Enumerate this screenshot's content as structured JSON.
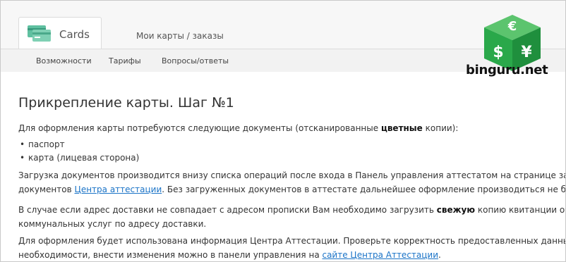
{
  "header": {
    "brand": "Cards",
    "main_link": "Мои карты / заказы",
    "subnav": [
      "Возможности",
      "Тарифы",
      "Вопросы/ответы"
    ]
  },
  "watermark": {
    "text": "binguru.net",
    "symbols": [
      "€",
      "$",
      "¥"
    ]
  },
  "content": {
    "title": "Прикрепление карты. Шаг №1",
    "p1_before": "Для оформления карты потребуются следующие документы (отсканированные ",
    "p1_bold": "цветные",
    "p1_after": " копии):",
    "bullets": [
      "паспорт",
      "карта (лицевая сторона)"
    ],
    "p2_line1": "Загрузка документов производится внизу списка операций после входа в Панель управления аттестатом на странице загрузки",
    "p2_line2_before": "документов ",
    "p2_link": "Центра аттестации",
    "p2_line2_after": ". Без загруженных документов в аттестате дальнейшее оформление производиться не будет.",
    "p3_line1_before": "В случае если адрес доставки не совпадает с адресом прописки Вам необходимо загрузить ",
    "p3_bold": "свежую",
    "p3_line1_after": " копию квитанции об оплате",
    "p3_line2": "коммунальных услуг по адресу доставки.",
    "p4_line1": "Для оформления будет использована информация Центра Аттестации. Проверьте корректность предоставленных данных. При",
    "p4_line2_before": "необходимости, внести изменения можно в панели управления на ",
    "p4_link": "сайте Центра Аттестации",
    "p4_line2_after": "."
  },
  "colors": {
    "link": "#1a73c7",
    "watermark_green": "#2aa84a",
    "brand_icon": "#5fc0a0"
  }
}
